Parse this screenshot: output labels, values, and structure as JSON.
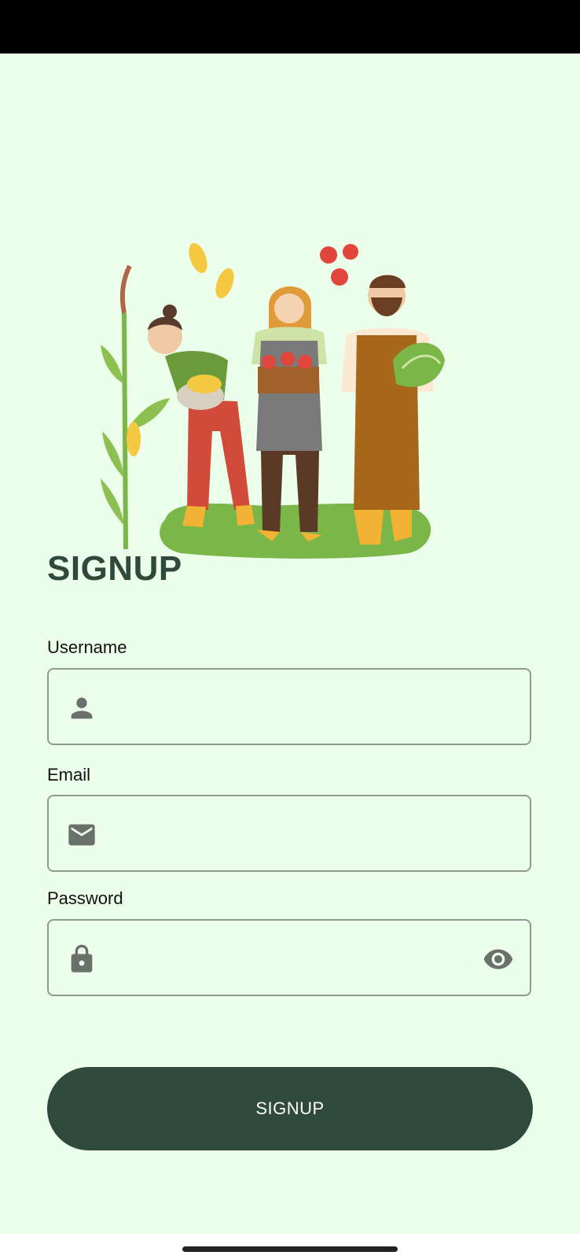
{
  "colors": {
    "background": "#ecffeb",
    "primary": "#2f4a3c",
    "field_border": "#8e9a92",
    "icon": "#6b706c"
  },
  "illustration": {
    "name": "farmers-illustration"
  },
  "form": {
    "title": "SIGNUP",
    "username": {
      "label": "Username",
      "value": "",
      "icon": "person-icon"
    },
    "email": {
      "label": "Email",
      "value": "",
      "icon": "mail-icon"
    },
    "password": {
      "label": "Password",
      "value": "",
      "icon": "lock-icon",
      "toggle_icon": "eye-icon"
    },
    "submit_label": "SIGNUP"
  }
}
